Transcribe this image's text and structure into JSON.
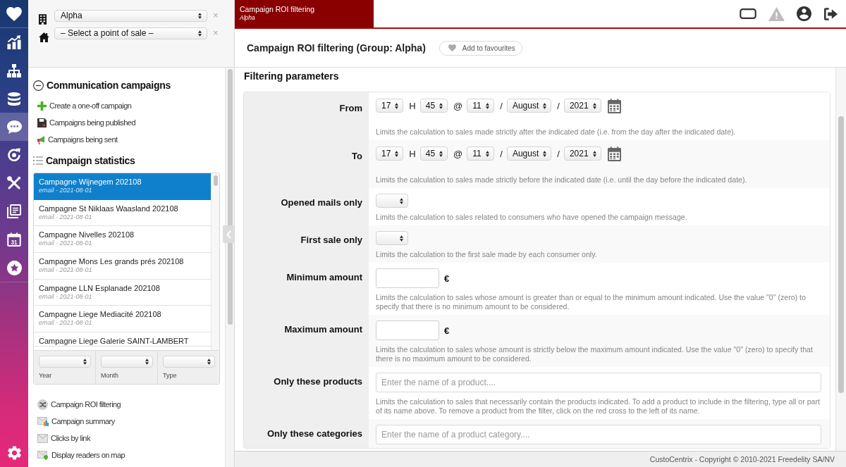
{
  "nav": {
    "items": [
      {
        "kind": "heart",
        "selected": false
      },
      {
        "kind": "chart",
        "selected": false
      },
      {
        "kind": "hierarchy",
        "selected": false
      },
      {
        "kind": "database",
        "selected": false
      },
      {
        "kind": "chat",
        "selected": true
      },
      {
        "kind": "sync",
        "selected": false
      },
      {
        "kind": "tools",
        "selected": false
      },
      {
        "kind": "notes",
        "selected": false
      },
      {
        "kind": "calendar",
        "label": "31",
        "selected": false
      },
      {
        "kind": "star",
        "selected": false
      }
    ],
    "bottom": [
      {
        "kind": "settings",
        "selected": false
      }
    ]
  },
  "context": {
    "selectors": [
      {
        "kind": "group",
        "value": "Alpha",
        "clear": "×"
      },
      {
        "kind": "point_of_sale",
        "value": "– Select a point of sale –",
        "clear": "×"
      }
    ]
  },
  "communication": {
    "title": "Communication campaigns",
    "expanded": true,
    "links": [
      {
        "kind": "create",
        "label": "Create a one-off campaign"
      },
      {
        "kind": "published",
        "label": "Campaigns being published"
      },
      {
        "kind": "sent",
        "label": "Campaigns being sent"
      }
    ]
  },
  "statistics": {
    "title": "Campaign statistics",
    "campaigns": [
      {
        "title": "Campagne Wijnegem 202108",
        "subtitle": "email - 2021-08-01",
        "selected": true
      },
      {
        "title": "Campagne St Niklaas Waasland 202108",
        "subtitle": "email - 2021-08-01",
        "selected": false
      },
      {
        "title": "Campagne Nivelles 202108",
        "subtitle": "email - 2021-08-01",
        "selected": false
      },
      {
        "title": "Campagne Mons Les grands prés 202108",
        "subtitle": "email - 2021-08-01",
        "selected": false
      },
      {
        "title": "Campagne LLN Esplanade 202108",
        "subtitle": "email - 2021-08-01",
        "selected": false
      },
      {
        "title": "Campagne Liege Mediacité 202108",
        "subtitle": "email - 2021-08-01",
        "selected": false
      },
      {
        "title": "Campagne Liege Galerie SAINT-LAMBERT",
        "selected": false
      }
    ],
    "filters": [
      {
        "label": "Year"
      },
      {
        "label": "Month"
      },
      {
        "label": "Type"
      }
    ],
    "links": [
      {
        "kind": "roi",
        "label": "Campaign ROI filtering"
      },
      {
        "kind": "summary",
        "label": "Campaign summary"
      },
      {
        "kind": "clicks",
        "label": "Clicks by link"
      },
      {
        "kind": "map",
        "label": "Display readers on map"
      }
    ]
  },
  "tab": {
    "title": "Campaign ROI filtering",
    "subtitle": "Alpha"
  },
  "toolbar": [
    {
      "kind": "tablet",
      "disabled": false
    },
    {
      "kind": "warning",
      "disabled": true
    },
    {
      "kind": "account",
      "disabled": false
    },
    {
      "kind": "logout",
      "disabled": false
    }
  ],
  "header": {
    "title": "Campaign ROI filtering (Group: Alpha)",
    "favourite_button": "Add to favourites"
  },
  "form": {
    "title": "Filtering parameters",
    "fields": [
      {
        "kind": "datetime",
        "label": "From",
        "parts": [
          {
            "kind": "select",
            "value": "17"
          },
          {
            "kind": "sep",
            "value": "H"
          },
          {
            "kind": "select",
            "value": "45"
          },
          {
            "kind": "sep",
            "value": "@"
          },
          {
            "kind": "select",
            "value": "11"
          },
          {
            "kind": "sep",
            "value": "/"
          },
          {
            "kind": "select",
            "value": "August"
          },
          {
            "kind": "sep",
            "value": "/"
          },
          {
            "kind": "select",
            "value": "2021"
          },
          {
            "kind": "calendar"
          }
        ],
        "description": "Limits the calculation to sales made strictly after the indicated date (i.e. from the day after the indicated date)."
      },
      {
        "kind": "datetime",
        "label": "To",
        "parts": [
          {
            "kind": "select",
            "value": "17"
          },
          {
            "kind": "sep",
            "value": "H"
          },
          {
            "kind": "select",
            "value": "45"
          },
          {
            "kind": "sep",
            "value": "@"
          },
          {
            "kind": "select",
            "value": "11"
          },
          {
            "kind": "sep",
            "value": "/"
          },
          {
            "kind": "select",
            "value": "August"
          },
          {
            "kind": "sep",
            "value": "/"
          },
          {
            "kind": "select",
            "value": "2021"
          },
          {
            "kind": "calendar"
          }
        ],
        "description": "Limits the calculation to sales made strictly before the indicated date (i.e. until the day before the indicated date)."
      },
      {
        "kind": "select",
        "label": "Opened mails only",
        "description": "Limits the calculation to sales related to consumers who have opened the campaign message."
      },
      {
        "kind": "select",
        "label": "First sale only",
        "description": "Limits the calculation to the first sale made by each consumer only."
      },
      {
        "kind": "amount",
        "label": "Minimum amount",
        "currency": "€",
        "description": "Limits the calculation to sales whose amount is greater than or equal to the minimum amount indicated. Use the value \"0\" (zero) to specify that there is no minimum amount to be considered."
      },
      {
        "kind": "amount",
        "label": "Maximum amount",
        "currency": "€",
        "description": "Limits the calculation to sales whose amount is strictly below the maximum amount indicated. Use the value \"0\" (zero) to specify that there is no maximum amount to be considered."
      },
      {
        "kind": "text",
        "label": "Only these products",
        "placeholder": "Enter the name of a product....",
        "description": "Limits the calculation to sales that necessarily contain the products indicated. To add a product to include in the filtering, type all or part of its name above. To remove a product from the filter, click on the red cross to the left of its name."
      },
      {
        "kind": "text",
        "label": "Only these categories",
        "placeholder": "Enter the name of a product category...."
      }
    ]
  },
  "footer": {
    "copyright": "CustoCentrix - Copyright © 2010-2021 Freedelity SA/NV"
  }
}
